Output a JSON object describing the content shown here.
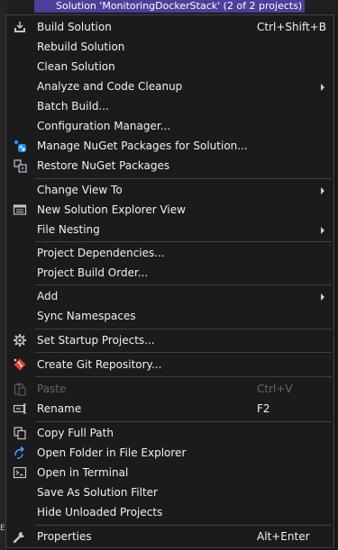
{
  "background": {
    "solution_header": "Solution 'MonitoringDockerStack' (2 of 2 projects)",
    "left_edge_text": "ED"
  },
  "menu": {
    "items": [
      {
        "label": "Build Solution",
        "shortcut": "Ctrl+Shift+B",
        "icon": "build-icon"
      },
      {
        "label": "Rebuild Solution",
        "shortcut": "",
        "icon": ""
      },
      {
        "label": "Clean Solution",
        "shortcut": "",
        "icon": ""
      },
      {
        "label": "Analyze and Code Cleanup",
        "shortcut": "",
        "icon": "",
        "submenu": true
      },
      {
        "label": "Batch Build...",
        "shortcut": "",
        "icon": ""
      },
      {
        "label": "Configuration Manager...",
        "shortcut": "",
        "icon": ""
      },
      {
        "label": "Manage NuGet Packages for Solution...",
        "shortcut": "",
        "icon": "nuget-icon"
      },
      {
        "label": "Restore NuGet Packages",
        "shortcut": "",
        "icon": "restore-icon"
      },
      {
        "label": "Change View To",
        "shortcut": "",
        "icon": "",
        "submenu": true
      },
      {
        "label": "New Solution Explorer View",
        "shortcut": "",
        "icon": "window-icon"
      },
      {
        "label": "File Nesting",
        "shortcut": "",
        "icon": "",
        "submenu": true
      },
      {
        "label": "Project Dependencies...",
        "shortcut": "",
        "icon": ""
      },
      {
        "label": "Project Build Order...",
        "shortcut": "",
        "icon": ""
      },
      {
        "label": "Add",
        "shortcut": "",
        "icon": "",
        "submenu": true
      },
      {
        "label": "Sync Namespaces",
        "shortcut": "",
        "icon": ""
      },
      {
        "label": "Set Startup Projects...",
        "shortcut": "",
        "icon": "gear-icon"
      },
      {
        "label": "Create Git Repository...",
        "shortcut": "",
        "icon": "git-icon"
      },
      {
        "label": "Paste",
        "shortcut": "Ctrl+V",
        "icon": "paste-icon",
        "disabled": true
      },
      {
        "label": "Rename",
        "shortcut": "F2",
        "icon": "rename-icon"
      },
      {
        "label": "Copy Full Path",
        "shortcut": "",
        "icon": "copy-icon"
      },
      {
        "label": "Open Folder in File Explorer",
        "shortcut": "",
        "icon": "open-folder-icon"
      },
      {
        "label": "Open in Terminal",
        "shortcut": "",
        "icon": "terminal-icon"
      },
      {
        "label": "Save As Solution Filter",
        "shortcut": "",
        "icon": ""
      },
      {
        "label": "Hide Unloaded Projects",
        "shortcut": "",
        "icon": ""
      },
      {
        "label": "Properties",
        "shortcut": "Alt+Enter",
        "icon": "wrench-icon"
      }
    ]
  },
  "colors": {
    "menu_background": "#1b1b1c",
    "menu_border": "#434346",
    "text": "#f1f1f1",
    "disabled_text": "#656565",
    "separator": "#3f3f46",
    "header_selection": "#4d3f9a",
    "nuget_blue": "#1e90ff",
    "git_red": "#e8412c"
  }
}
